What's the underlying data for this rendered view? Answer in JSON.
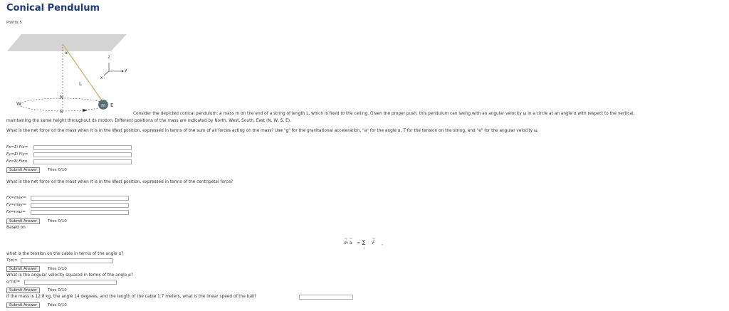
{
  "title": "Conical Pendulum",
  "points": "Points:5",
  "figure": {
    "labels": {
      "alpha": "α",
      "z": "z",
      "y": "y",
      "x": "x",
      "L": "L",
      "N": "N",
      "S": "S",
      "W": "W",
      "E": "E",
      "m": "m"
    }
  },
  "description_line1": "Consider the depicted conical pendulum: a mass m on the end of a string of length L, which is fixed to the ceiling. Given the proper push, this pendulum can swing with an angular velocity ω in a circle at an angle α with respect to the vertical,",
  "description_line2": "maintaining the same height throughout its motion. Different positions of the mass are indicated by North, West, South, East (N, W, S, E).",
  "q1": {
    "text": "What is the net force on the mass when it is in the West position, expressed in terms of the sum of all forces acting on the mass? Use \"g\" for the gravitational acceleration, \"a\" for the angle α, T for the tension on the string, and \"e\" for the angular velocity ω.",
    "labels": [
      "Fx=Σi Fix=",
      "Fy=Σi Fiy=",
      "Fz=Σi Fiz="
    ],
    "submit": "Submit Answer",
    "tries": "Tries 0/10"
  },
  "q2": {
    "text": "What is the net force on the mass when it is in the West position, expressed in terms of the centripetal force?",
    "labels": [
      "Fx=max=",
      "Fy=may=",
      "Fz=maz="
    ],
    "submit": "Submit Answer",
    "tries": "Tries 0/10",
    "based_on": "Based on"
  },
  "equation": {
    "lhs": "m a",
    "eq": "=",
    "sigma": "Σ",
    "sub": "i",
    "rhs": "F",
    "tail": ","
  },
  "q3": {
    "text": "what is the tension on the cable in terms of the angle α?",
    "label": "T(α)=",
    "submit": "Submit Answer",
    "tries": "Tries 0/10"
  },
  "q4": {
    "text": "What is the angular velocity squared in terms of the angle α?",
    "label": "ω²(α)=",
    "submit": "Submit Answer",
    "tries": "Tries 0/10"
  },
  "q5": {
    "text": "If the mass is 12.8 kg, the angle 14 degrees, and the length of the cable 1.7 meters, what is the linear speed of the ball?",
    "submit": "Submit Answer",
    "tries": "Tries 0/10"
  }
}
